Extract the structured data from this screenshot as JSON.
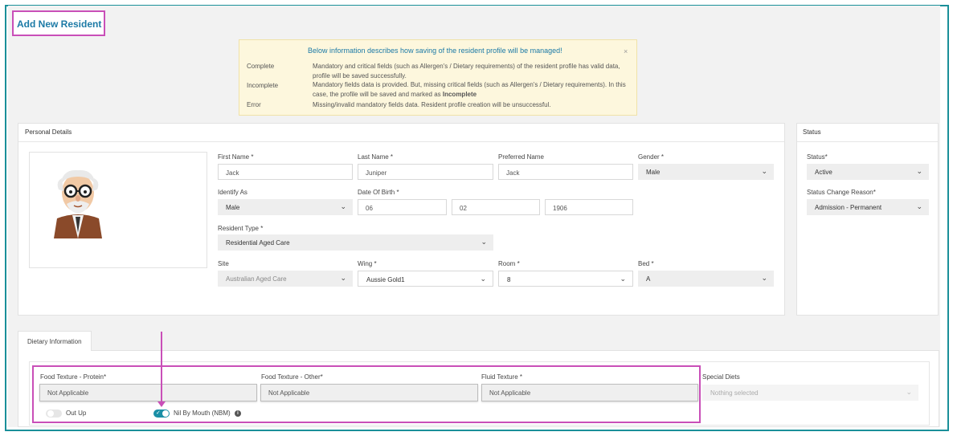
{
  "page_title": "Add New Resident",
  "info": {
    "title": "Below information describes how saving of the resident profile will be managed!",
    "close": "×",
    "rows": [
      {
        "label": "Complete",
        "text": "Mandatory and critical fields (such as Allergen's / Dietary requirements) of the resident profile has valid data, profile will be saved successfully."
      },
      {
        "label": "Incomplete",
        "text": "Mandatory fields data is provided. But, missing critical fields (such as Allergen's / Dietary requirements). In this case, the profile will be saved and marked as ",
        "bold": "Incomplete"
      },
      {
        "label": "Error",
        "text": "Missing/invalid mandatory fields data. Resident profile creation will be unsuccessful."
      }
    ]
  },
  "personal": {
    "header": "Personal Details",
    "first_name": {
      "label": "First Name *",
      "value": "Jack"
    },
    "last_name": {
      "label": "Last Name *",
      "value": "Juniper"
    },
    "preferred_name": {
      "label": "Preferred Name",
      "value": "Jack"
    },
    "gender": {
      "label": "Gender *",
      "value": "Male"
    },
    "identify_as": {
      "label": "Identify As",
      "value": "Male"
    },
    "dob": {
      "label": "Date Of Birth *",
      "day": "06",
      "month": "02",
      "year": "1906"
    },
    "resident_type": {
      "label": "Resident Type *",
      "value": "Residential Aged Care"
    },
    "site": {
      "label": "Site",
      "value": "Australian Aged Care"
    },
    "wing": {
      "label": "Wing *",
      "value": "Aussie Gold1"
    },
    "room": {
      "label": "Room *",
      "value": "8"
    },
    "bed": {
      "label": "Bed *",
      "value": "A"
    }
  },
  "status": {
    "header": "Status",
    "status": {
      "label": "Status*",
      "value": "Active"
    },
    "reason": {
      "label": "Status Change Reason*",
      "value": "Admission - Permanent"
    }
  },
  "dietary": {
    "tab": "Dietary Information",
    "food_protein": {
      "label": "Food Texture - Protein*",
      "value": "Not Applicable"
    },
    "food_other": {
      "label": "Food Texture - Other*",
      "value": "Not Applicable"
    },
    "fluid": {
      "label": "Fluid Texture *",
      "value": "Not Applicable"
    },
    "special_diets": {
      "label": "Special Diets",
      "value": "Nothing selected"
    },
    "out_up": {
      "label": "Out Up",
      "on": false
    },
    "nbm": {
      "label": "Nil By Mouth (NBM)",
      "on": true
    }
  },
  "icons": {
    "chevron": "⌄",
    "info": "i",
    "check": "✓"
  },
  "colors": {
    "accent": "#1a8fa6",
    "title": "#1c7aa6",
    "highlight": "#c94fb8",
    "info_bg": "#fdf7dd"
  }
}
